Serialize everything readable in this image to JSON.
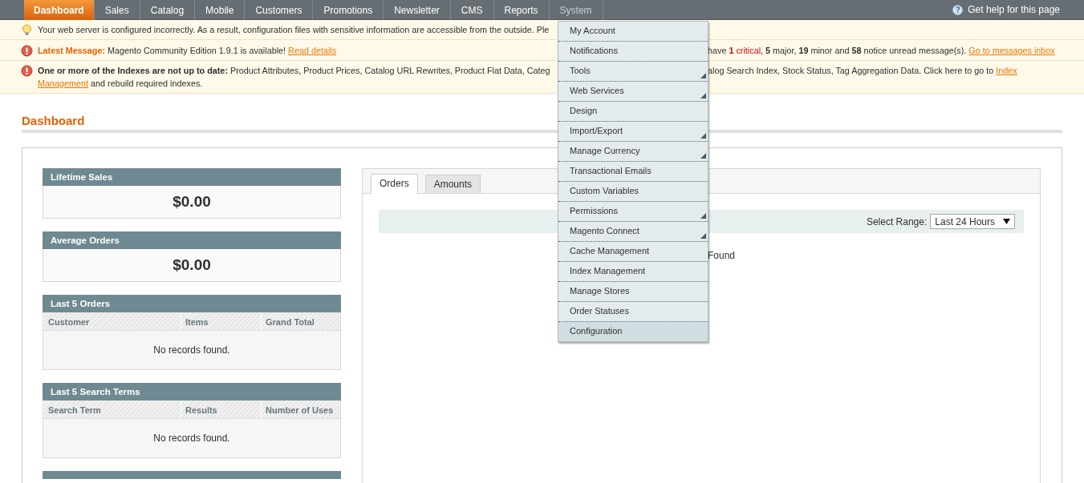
{
  "nav": {
    "items": [
      {
        "label": "Dashboard",
        "selected": true,
        "expanded": false
      },
      {
        "label": "Sales",
        "selected": false,
        "expanded": false
      },
      {
        "label": "Catalog",
        "selected": false,
        "expanded": false
      },
      {
        "label": "Mobile",
        "selected": false,
        "expanded": false
      },
      {
        "label": "Customers",
        "selected": false,
        "expanded": false
      },
      {
        "label": "Promotions",
        "selected": false,
        "expanded": false
      },
      {
        "label": "Newsletter",
        "selected": false,
        "expanded": false
      },
      {
        "label": "CMS",
        "selected": false,
        "expanded": false
      },
      {
        "label": "Reports",
        "selected": false,
        "expanded": false
      },
      {
        "label": "System",
        "selected": false,
        "expanded": true
      }
    ],
    "help_icon": "?",
    "help": "Get help for this page"
  },
  "system_menu": [
    {
      "label": "My Account",
      "has_submenu": false,
      "highlighted": false
    },
    {
      "label": "Notifications",
      "has_submenu": false,
      "highlighted": false
    },
    {
      "label": "Tools",
      "has_submenu": true,
      "highlighted": false
    },
    {
      "label": "Web Services",
      "has_submenu": true,
      "highlighted": false
    },
    {
      "label": "Design",
      "has_submenu": false,
      "highlighted": false
    },
    {
      "label": "Import/Export",
      "has_submenu": true,
      "highlighted": false
    },
    {
      "label": "Manage Currency",
      "has_submenu": true,
      "highlighted": false
    },
    {
      "label": "Transactional Emails",
      "has_submenu": false,
      "highlighted": false
    },
    {
      "label": "Custom Variables",
      "has_submenu": false,
      "highlighted": false
    },
    {
      "label": "Permissions",
      "has_submenu": true,
      "highlighted": false
    },
    {
      "label": "Magento Connect",
      "has_submenu": true,
      "highlighted": false
    },
    {
      "label": "Cache Management",
      "has_submenu": false,
      "highlighted": false
    },
    {
      "label": "Index Management",
      "has_submenu": false,
      "highlighted": false
    },
    {
      "label": "Manage Stores",
      "has_submenu": false,
      "highlighted": false
    },
    {
      "label": "Order Statuses",
      "has_submenu": false,
      "highlighted": false
    },
    {
      "label": "Configuration",
      "has_submenu": false,
      "highlighted": true
    }
  ],
  "messages": [
    {
      "kind": "notice",
      "lines": [
        {
          "left": [
            {
              "kind": "text",
              "text": "Your web server is configured incorrectly. As a result, configuration files with sensitive information are accessible from the outside. Ple"
            }
          ]
        }
      ]
    },
    {
      "kind": "error",
      "lines": [
        {
          "left": [
            {
              "kind": "title",
              "text": "Latest Message:"
            },
            {
              "kind": "text",
              "text": "Magento Community Edition 1.9.1 is available!"
            },
            {
              "kind": "link",
              "text": "Read details"
            }
          ],
          "right": [
            {
              "kind": "summary",
              "parts": [
                {
                  "kind": "plain",
                  "text": "have "
                },
                {
                  "kind": "critical-count",
                  "text": "1"
                },
                {
                  "kind": "critical",
                  "text": " critical"
                },
                {
                  "kind": "plain",
                  "text": ", "
                },
                {
                  "kind": "count",
                  "text": "5"
                },
                {
                  "kind": "plain",
                  "text": " major, "
                },
                {
                  "kind": "count",
                  "text": "19"
                },
                {
                  "kind": "plain",
                  "text": " minor and "
                },
                {
                  "kind": "count",
                  "text": "58"
                },
                {
                  "kind": "plain",
                  "text": " notice unread message(s)."
                }
              ]
            },
            {
              "kind": "link",
              "text": "Go to messages inbox"
            }
          ]
        }
      ]
    },
    {
      "kind": "error",
      "lines": [
        {
          "left": [
            {
              "kind": "text",
              "text": "**One or more of the Indexes are not up to date:** Product Attributes, Product Prices, Catalog URL Rewrites, Product Flat Data, Categ"
            }
          ],
          "right": [
            {
              "kind": "text",
              "text": "alog Search Index, Stock Status, Tag Aggregation Data. Click here to go to"
            },
            {
              "kind": "link",
              "text": "Index"
            }
          ]
        },
        {
          "left": [
            {
              "kind": "link",
              "text": "Management"
            },
            {
              "kind": "text",
              "text": "and rebuild required indexes."
            }
          ]
        }
      ]
    }
  ],
  "page_title": "Dashboard",
  "stats": [
    {
      "title": "Lifetime Sales",
      "value": "$0.00"
    },
    {
      "title": "Average Orders",
      "value": "$0.00"
    }
  ],
  "grids": [
    {
      "title": "Last 5 Orders",
      "columns": [
        "Customer",
        "Items",
        "Grand Total"
      ],
      "empty": "No records found."
    },
    {
      "title": "Last 5 Search Terms",
      "columns": [
        "Search Term",
        "Results",
        "Number of Uses"
      ],
      "empty": "No records found."
    }
  ],
  "chart_panel": {
    "tabs": [
      {
        "label": "Orders",
        "selected": true
      },
      {
        "label": "Amounts",
        "selected": false
      }
    ],
    "range_label": "Select Range:",
    "range_value": "Last 24 Hours",
    "empty": "Found"
  }
}
